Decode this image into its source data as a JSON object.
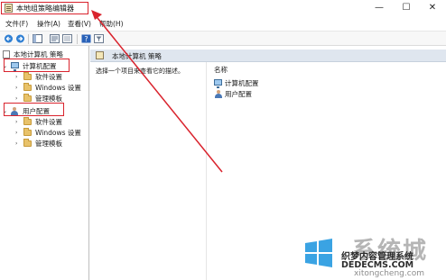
{
  "window": {
    "title": "本地组策略编辑器",
    "minimize_glyph": "—",
    "maximize_glyph": "☐",
    "close_glyph": "✕"
  },
  "menu": [
    {
      "label": "文件(F)"
    },
    {
      "label": "操作(A)"
    },
    {
      "label": "查看(V)"
    },
    {
      "label": "帮助(H)"
    }
  ],
  "toolbar": {
    "icons": [
      "back-icon",
      "forward-icon",
      "show-hide-tree-icon",
      "properties-icon",
      "export-list-icon",
      "help-icon",
      "filter-icon"
    ]
  },
  "tree": {
    "root_label": "本地计算机 策略",
    "computer_config": {
      "label": "计算机配置",
      "children": [
        "软件设置",
        "Windows 设置",
        "管理模板"
      ]
    },
    "user_config": {
      "label": "用户配置",
      "children": [
        "软件设置",
        "Windows 设置",
        "管理模板"
      ]
    }
  },
  "main": {
    "header_title": "本地计算机 策略",
    "description": "选择一个项目来查看它的描述。",
    "name_column": "名称",
    "items": [
      "计算机配置",
      "用户配置"
    ]
  },
  "annotation": {
    "highlight_color": "#d9232d"
  },
  "watermark": {
    "big_text": "系统城",
    "line1": "织梦内容管理系统",
    "line2": "DEDECMS.COM",
    "line3": "xitongcheng.com"
  }
}
